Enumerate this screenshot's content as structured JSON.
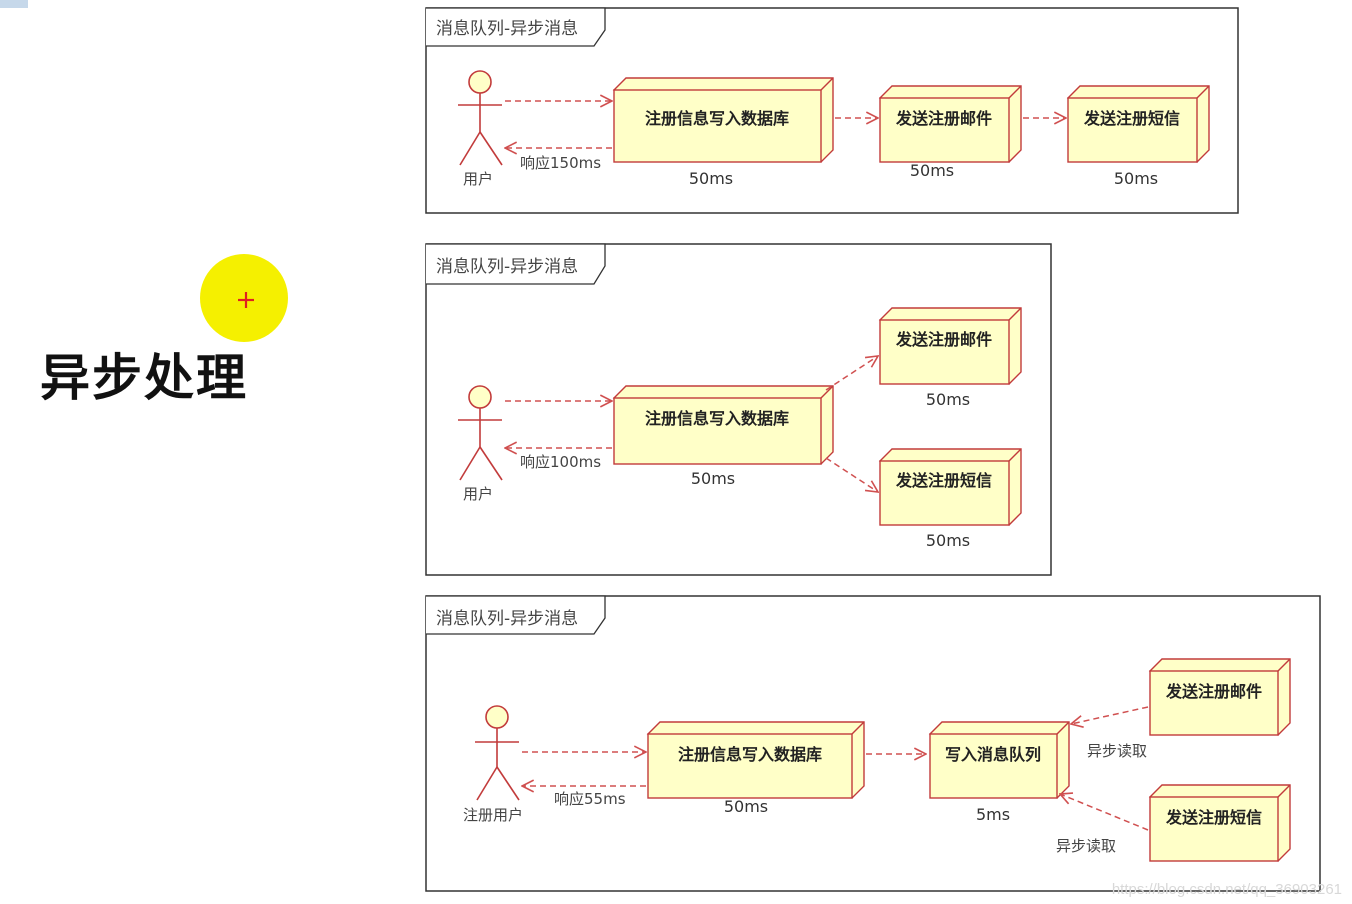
{
  "heading": "异步处理",
  "watermark": "https://blog.csdn.net/qq_36903261",
  "colors": {
    "node_fill": "#ffffc8",
    "node_stroke": "#c23b3b",
    "arrow": "#d05050",
    "frame": "#333333",
    "highlight": "#f5f000",
    "cursor": "#e02020"
  },
  "diagrams": [
    {
      "frame_label": "消息队列-异步消息",
      "actor": "用户",
      "request_arrow": "",
      "response": "响应150ms",
      "nodes": [
        {
          "label": "注册信息写入数据库",
          "time": "50ms"
        },
        {
          "label": "发送注册邮件",
          "time": "50ms"
        },
        {
          "label": "发送注册短信",
          "time": "50ms"
        }
      ]
    },
    {
      "frame_label": "消息队列-异步消息",
      "actor": "用户",
      "response": "响应100ms",
      "nodes": [
        {
          "label": "注册信息写入数据库",
          "time": "50ms"
        },
        {
          "label": "发送注册邮件",
          "time": "50ms"
        },
        {
          "label": "发送注册短信",
          "time": "50ms"
        }
      ]
    },
    {
      "frame_label": "消息队列-异步消息",
      "actor": "注册用户",
      "response": "响应55ms",
      "nodes": [
        {
          "label": "注册信息写入数据库",
          "time": "50ms"
        },
        {
          "label": "写入消息队列",
          "time": "5ms"
        },
        {
          "label": "发送注册邮件",
          "time": ""
        },
        {
          "label": "发送注册短信",
          "time": ""
        }
      ],
      "read_labels": [
        "异步读取",
        "异步读取"
      ]
    }
  ]
}
